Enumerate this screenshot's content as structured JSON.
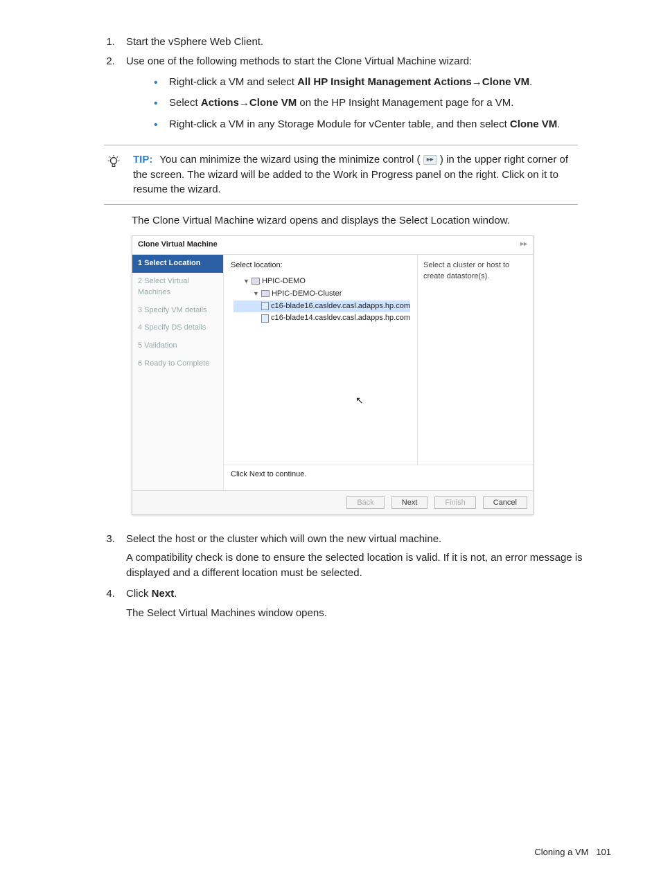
{
  "steps": {
    "s1": "Start the vSphere Web Client.",
    "s2": "Use one of the following methods to start the Clone Virtual Machine wizard:",
    "bullets": {
      "b1_pre": "Right-click a VM and select ",
      "b1_bold1": "All HP Insight Management Actions",
      "b1_arrow": "→",
      "b1_bold2": "Clone VM",
      "b1_post": ".",
      "b2_pre": "Select ",
      "b2_bold1": "Actions",
      "b2_arrow": "→",
      "b2_bold2": "Clone VM",
      "b2_post": " on the HP Insight Management page for a VM.",
      "b3_pre": "Right-click a VM in any Storage Module for vCenter table, and then select ",
      "b3_bold": "Clone VM",
      "b3_post": "."
    }
  },
  "tip": {
    "label": "TIP:",
    "text_a": "You can minimize the wizard using the minimize control (",
    "icon": "▸▸",
    "text_b": ") in the upper right corner of the screen. The wizard will be added to the Work in Progress panel on the right. Click on it to resume the wizard."
  },
  "after_tip": "The Clone Virtual Machine wizard opens and displays the Select Location window.",
  "wizard": {
    "title": "Clone Virtual Machine",
    "steps": [
      "1  Select Location",
      "2  Select Virtual Machines",
      "3  Specify VM details",
      "4  Specify DS details",
      "5  Validation",
      "6  Ready to Complete"
    ],
    "select_location_label": "Select location:",
    "tree": {
      "root": "HPIC-DEMO",
      "cluster": "HPIC-DEMO-Cluster",
      "host1": "c16-blade16.casldev.casl.adapps.hp.com",
      "host2": "c16-blade14.casldev.casl.adapps.hp.com"
    },
    "hint": "Select a cluster or host to create datastore(s).",
    "footnote": "Click Next to continue.",
    "buttons": {
      "back": "Back",
      "next": "Next",
      "finish": "Finish",
      "cancel": "Cancel"
    }
  },
  "steps2": {
    "s3a": "Select the host or the cluster which will own the new virtual machine.",
    "s3b": "A compatibility check is done to ensure the selected location is valid. If it is not, an error message is displayed and a different location must be selected.",
    "s4_pre": "Click ",
    "s4_bold": "Next",
    "s4_post": ".",
    "s4b": "The Select Virtual Machines window opens."
  },
  "footer": {
    "section": "Cloning a VM",
    "page": "101"
  }
}
